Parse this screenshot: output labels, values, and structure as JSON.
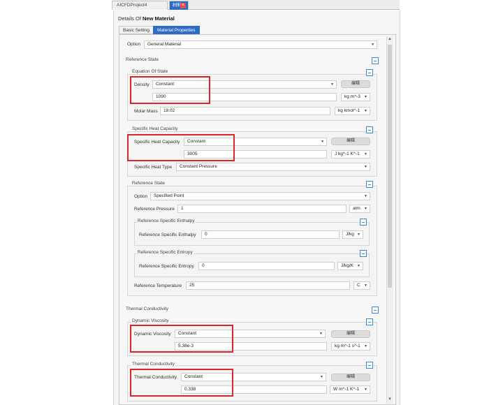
{
  "tabs": {
    "project": "AICFDProject4",
    "active": "材料",
    "close_icon": "close-icon"
  },
  "details": {
    "prefix": "Details Of ",
    "name": "New Material"
  },
  "subtabs": {
    "basic": "Basic Setting",
    "material": "Material Properties"
  },
  "option": {
    "label": "Option",
    "value": "General Material"
  },
  "reference_state": {
    "label": "Reference State"
  },
  "eos": {
    "label": "Equation Of State",
    "density": {
      "label": "Density",
      "method": "Constant",
      "value": "1090",
      "unit": "kg m^-3",
      "edit": "编辑"
    },
    "molar": {
      "label": "Molar Mass",
      "value": "18.02",
      "unit": "kg kmol^-1"
    }
  },
  "cp": {
    "label": "Specific Heat Capacity",
    "row": {
      "label": "Specific Heat Capacity",
      "method": "Constant",
      "value": "3005",
      "unit": "J kg^-1 K^-1",
      "edit": "编辑"
    },
    "type": {
      "label": "Specific Heat Type",
      "value": "Constant Pressure"
    }
  },
  "ref": {
    "label": "Reference State",
    "option": {
      "label": "Option",
      "value": "Specified Point"
    },
    "pressure": {
      "label": "Reference Pressure",
      "value": "1",
      "unit": "atm"
    },
    "enthalpy_group": "Reference Specific Enthalpy",
    "enthalpy": {
      "label": "Reference Specific Enthalpy",
      "value": "0",
      "unit": "J/kg"
    },
    "entropy_group": "Reference Specific Entropy",
    "entropy": {
      "label": "Reference Specific Entropy",
      "value": "0",
      "unit": "J/kg/K"
    },
    "temperature": {
      "label": "Reference Temperature",
      "value": "25",
      "unit": "C"
    }
  },
  "thermal": {
    "label": "Thermal Conductivity",
    "visc_group": "Dynamic Viscosity",
    "viscosity": {
      "label": "Dynamic Viscosity",
      "method": "Constant",
      "value": "5.38e-3",
      "unit": "kg m^-1 s^-1",
      "edit": "编辑"
    },
    "cond_group": "Thermal Conductivity",
    "conductivity": {
      "label": "Thermal Conductivity",
      "method": "Constant",
      "value": "0.338",
      "unit": "W m^-1 K^-1",
      "edit": "编辑"
    }
  }
}
